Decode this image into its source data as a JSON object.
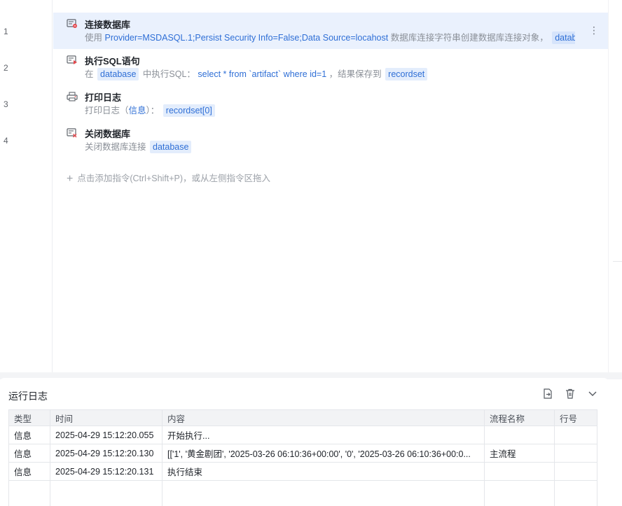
{
  "line_numbers": [
    "1",
    "2",
    "3",
    "4"
  ],
  "steps": [
    {
      "title": "连接数据库",
      "icon": "database-connect-icon",
      "desc": {
        "prefix": "使用",
        "conn": "Provider=MSDASQL.1;Persist Security Info=False;Data Source=locahost",
        "middle": "数据库连接字符串创建数据库连接对象，",
        "var": "database"
      }
    },
    {
      "title": "执行SQL语句",
      "icon": "sql-execute-icon",
      "desc": {
        "prefix": "在",
        "db": "database",
        "middle": "中执行SQL：",
        "sql": "select * from `artifact`  where id=1",
        "middle2": "，结果保存到",
        "result": "recordset"
      }
    },
    {
      "title": "打印日志",
      "icon": "print-log-icon",
      "desc": {
        "prefix": "打印日志",
        "paren_open": "（",
        "level": "信息",
        "paren_close": "）：",
        "value": "recordset[0]"
      }
    },
    {
      "title": "关闭数据库",
      "icon": "database-close-icon",
      "desc": {
        "prefix": "关闭数据库连接",
        "db": "database"
      }
    }
  ],
  "add_hint": "点击添加指令(Ctrl+Shift+P)，或从左侧指令区拖入",
  "log": {
    "title": "运行日志",
    "tools": [
      "export-icon",
      "trash-icon",
      "chevron-down-icon"
    ],
    "columns": [
      "类型",
      "时间",
      "内容",
      "流程名称",
      "行号"
    ],
    "rows": [
      [
        "信息",
        "2025-04-29 15:12:20.055",
        "开始执行...",
        "",
        ""
      ],
      [
        "信息",
        "2025-04-29 15:12:20.130",
        "[['1', '黄金剧团', '2025-03-26 06:10:36+00:00', '0', '2025-03-26 06:10:36+00:0...",
        "主流程",
        ""
      ],
      [
        "信息",
        "2025-04-29 15:12:20.131",
        "执行结束",
        "",
        ""
      ]
    ]
  },
  "colors": {
    "accent": "#2f6fd6",
    "selected_row": "#eaf1fd",
    "chip_bg": "#e3edfc",
    "icon_red": "#e5484d"
  }
}
